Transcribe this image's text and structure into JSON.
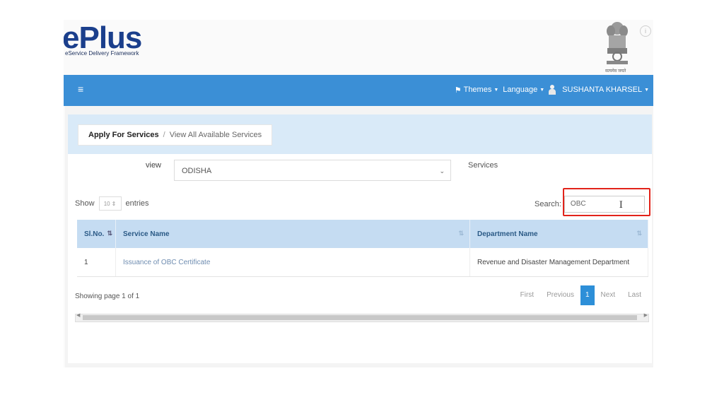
{
  "header": {
    "logo_text": "ePlus",
    "logo_subtitle": "eService Delivery Framework",
    "emblem_caption": "सत्यमेव जयते"
  },
  "navbar": {
    "menu_icon": "hamburger-icon",
    "themes_label": "Themes",
    "language_label": "Language",
    "user_name": "SUSHANTA KHARSEL",
    "color": "#3b8fd6"
  },
  "breadcrumb": {
    "parent": "Apply For Services",
    "separator": "/",
    "current": "View All Available Services"
  },
  "filters": {
    "view_label": "view",
    "view_value": "ODISHA",
    "services_label": "Services"
  },
  "table_controls": {
    "show_label": "Show",
    "entries_value": "10",
    "entries_label": "entries",
    "search_label": "Search:",
    "search_value": "OBC"
  },
  "table": {
    "columns": [
      "Sl.No.",
      "Service Name",
      "Department Name"
    ],
    "rows": [
      {
        "sl": "1",
        "service": "Issuance of OBC Certificate",
        "department": "Revenue and Disaster Management Department"
      }
    ]
  },
  "pagination": {
    "info": "Showing page 1 of 1",
    "first": "First",
    "previous": "Previous",
    "current": "1",
    "next": "Next",
    "last": "Last"
  },
  "colors": {
    "highlight": "#e2231a",
    "accent": "#2d8fd8"
  }
}
